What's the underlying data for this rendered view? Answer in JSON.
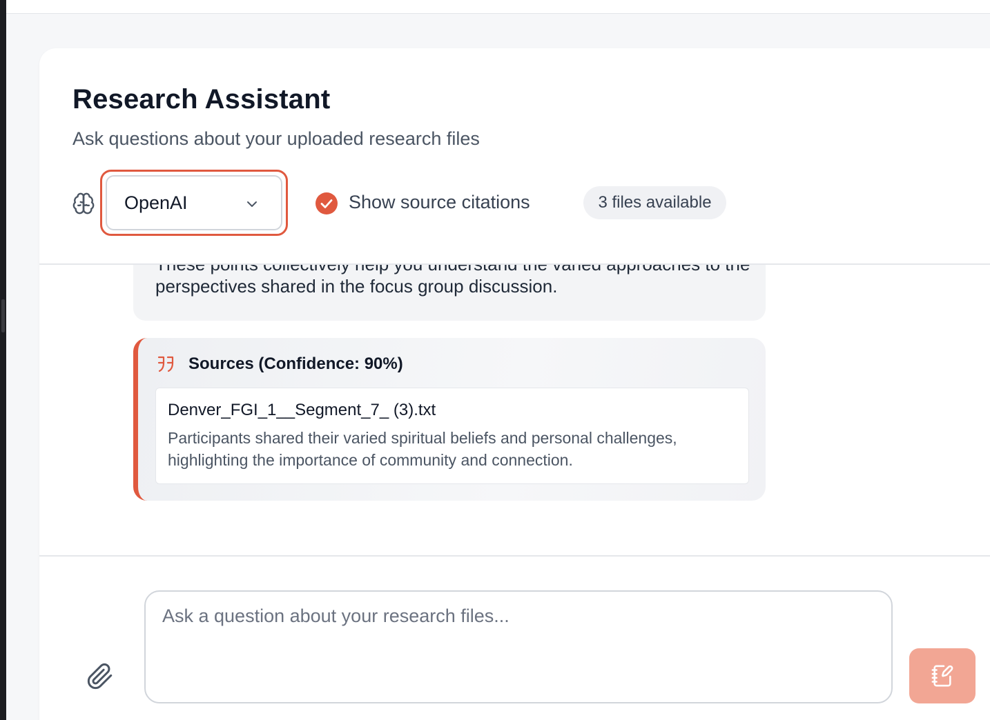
{
  "header": {
    "title": "Research Assistant",
    "subtitle": "Ask questions about your uploaded research files"
  },
  "controls": {
    "model_selected": "OpenAI",
    "citations_label": "Show source citations",
    "citations_checked": true,
    "files_badge": "3 files available"
  },
  "chat": {
    "message_cut_text": "These points collectively help you understand the varied approaches to the",
    "message_last_line": "perspectives shared in the focus group discussion.",
    "sources": {
      "title": "Sources (Confidence: 90%)",
      "items": [
        {
          "file": "Denver_FGI_1__Segment_7_ (3).txt",
          "snippet": "Participants shared their varied spiritual beliefs and personal challenges, highlighting the importance of community and connection."
        }
      ]
    }
  },
  "composer": {
    "placeholder": "Ask a question about your research files..."
  },
  "colors": {
    "accent": "#e0593f",
    "send_button": "#f2a694"
  },
  "icons": {
    "model": "brain-icon",
    "dropdown": "chevron-down-icon",
    "citations": "check-circle-icon",
    "quote": "quote-icon",
    "attach": "paperclip-icon",
    "send": "notebook-pen-icon"
  }
}
